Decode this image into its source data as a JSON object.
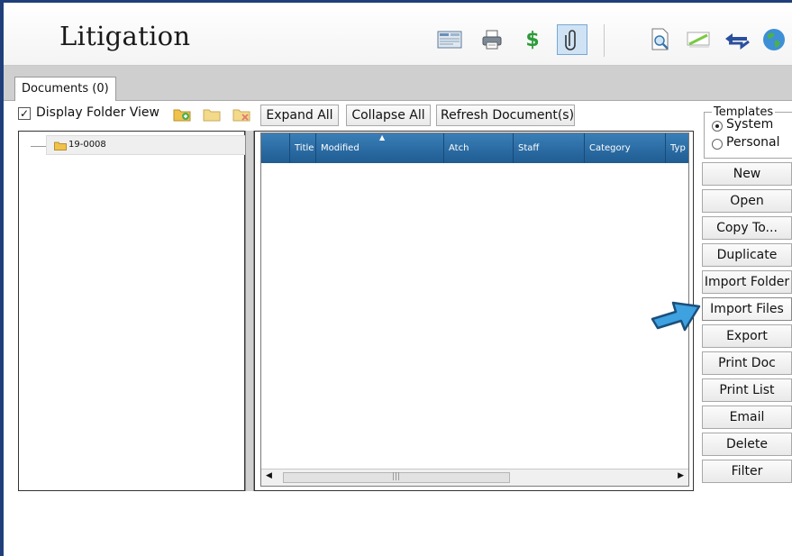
{
  "window": {
    "title": "Litigation"
  },
  "toolbar_icons": [
    "form-icon",
    "printer-icon",
    "dollar-icon",
    "paperclip-icon",
    "preview-icon",
    "highlighter-icon",
    "transfer-arrows-icon",
    "globe-icon"
  ],
  "tabs": [
    {
      "label": "Documents (0)"
    }
  ],
  "folder_toolbar": {
    "display_folder_view_label": "Display Folder View",
    "display_folder_view_checked": true,
    "expand_all_label": "Expand All",
    "collapse_all_label": "Collapse All",
    "refresh_label": "Refresh Document(s)"
  },
  "tree": {
    "nodes": [
      {
        "label": "19-0008"
      }
    ]
  },
  "grid": {
    "columns": [
      "",
      "Title",
      "Modified",
      "Atch",
      "Staff",
      "Category",
      "Typ"
    ],
    "rows": []
  },
  "templates": {
    "legend": "Templates",
    "options": [
      {
        "label": "System",
        "selected": true
      },
      {
        "label": "Personal",
        "selected": false
      }
    ]
  },
  "actions": [
    "New",
    "Open",
    "Copy To...",
    "Duplicate",
    "Import Folder",
    "Import Files",
    "Export",
    "Print Doc",
    "Print List",
    "Email",
    "Delete",
    "Filter"
  ],
  "colors": {
    "accent": "#1f5c92",
    "frame": "#1f3f7a",
    "callout_arrow": "#3ea1e0"
  }
}
